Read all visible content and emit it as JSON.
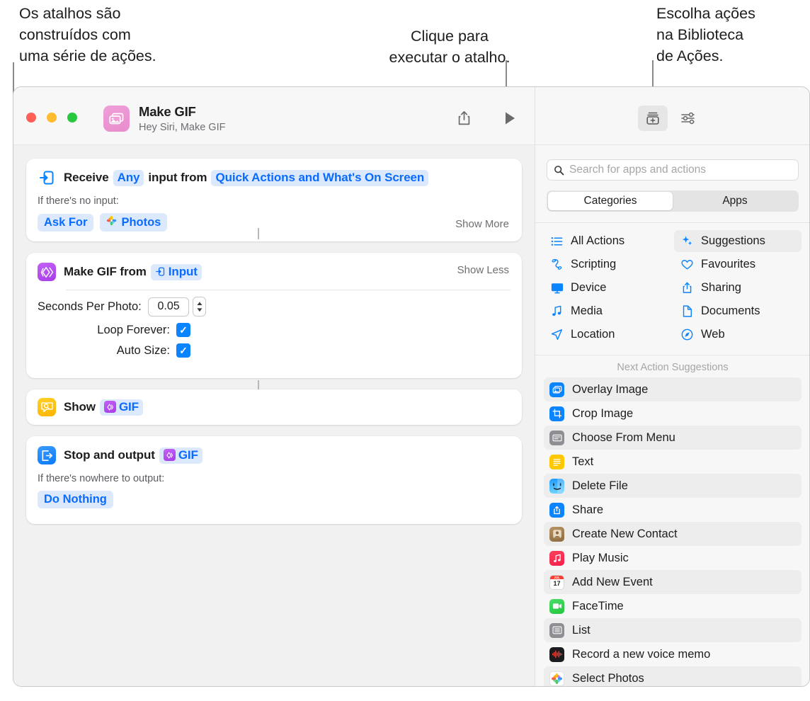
{
  "annotations": {
    "left": "Os atalhos são\nconstruídos com\numa série de ações.",
    "middle": "Clique para\nexecutar o atalho.",
    "right": "Escolha ações\nna Biblioteca\nde Ações."
  },
  "window": {
    "title": "Make GIF",
    "subtitle": "Hey Siri, Make GIF",
    "toolbar": {
      "share": "share-icon",
      "play": "play-icon",
      "library": "action-library-icon",
      "settings": "shortcut-details-icon"
    }
  },
  "actions": [
    {
      "icon": "receive-input-icon",
      "icon_color": "#0a84ff",
      "title_parts": [
        {
          "text": "Receive",
          "type": "plain"
        },
        {
          "text": "Any",
          "type": "token"
        },
        {
          "text": "input from",
          "type": "plain"
        },
        {
          "text": "Quick Actions and What's On Screen",
          "type": "token"
        }
      ],
      "toggle": "Show More",
      "sub_label": "If there's no input:",
      "chips": [
        {
          "label": "Ask For",
          "icon": null
        },
        {
          "label": "Photos",
          "icon": "photos-icon"
        }
      ]
    },
    {
      "icon": "make-gif-icon",
      "icon_color": "#b44cf0",
      "title_parts": [
        {
          "text": "Make GIF from",
          "type": "plain"
        },
        {
          "text": "Input",
          "type": "token",
          "icon": "input-variable-icon"
        }
      ],
      "toggle": "Show Less",
      "params": [
        {
          "label": "Seconds Per Photo:",
          "type": "number",
          "value": "0.05"
        },
        {
          "label": "Loop Forever:",
          "type": "checkbox",
          "checked": true
        },
        {
          "label": "Auto Size:",
          "type": "checkbox",
          "checked": true
        }
      ]
    },
    {
      "icon": "quick-look-icon",
      "icon_color": "#ffc107",
      "title_parts": [
        {
          "text": "Show",
          "type": "plain"
        },
        {
          "text": "GIF",
          "type": "token",
          "icon": "gif-variable-icon"
        }
      ]
    },
    {
      "icon": "stop-output-icon",
      "icon_color": "#0a84ff",
      "title_parts": [
        {
          "text": "Stop and output",
          "type": "plain"
        },
        {
          "text": "GIF",
          "type": "token",
          "icon": "gif-variable-icon"
        }
      ],
      "sub_label": "If there's nowhere to output:",
      "chips": [
        {
          "label": "Do Nothing",
          "icon": null
        }
      ]
    }
  ],
  "sidebar": {
    "search": {
      "placeholder": "Search for apps and actions",
      "icon": "search-icon"
    },
    "tabs": [
      {
        "label": "Categories",
        "active": true
      },
      {
        "label": "Apps",
        "active": false
      }
    ],
    "categories": [
      {
        "label": "All Actions",
        "icon": "list-bullet-icon",
        "selected": false
      },
      {
        "label": "Suggestions",
        "icon": "sparkles-icon",
        "selected": true
      },
      {
        "label": "Scripting",
        "icon": "scroll-icon",
        "selected": false
      },
      {
        "label": "Favourites",
        "icon": "heart-icon",
        "selected": false
      },
      {
        "label": "Device",
        "icon": "display-icon",
        "selected": false
      },
      {
        "label": "Sharing",
        "icon": "share-icon",
        "selected": false
      },
      {
        "label": "Media",
        "icon": "music-note-icon",
        "selected": false
      },
      {
        "label": "Documents",
        "icon": "document-icon",
        "selected": false
      },
      {
        "label": "Location",
        "icon": "paper-plane-icon",
        "selected": false
      },
      {
        "label": "Web",
        "icon": "safari-icon",
        "selected": false
      }
    ],
    "suggestions_title": "Next Action Suggestions",
    "suggestions": [
      {
        "label": "Overlay Image",
        "icon": "overlay-image-icon",
        "color": "#0a84ff"
      },
      {
        "label": "Crop Image",
        "icon": "crop-image-icon",
        "color": "#0a84ff"
      },
      {
        "label": "Choose From Menu",
        "icon": "menu-icon",
        "color": "#8e8e93"
      },
      {
        "label": "Text",
        "icon": "text-icon",
        "color": "#ffc800"
      },
      {
        "label": "Delete File",
        "icon": "finder-icon",
        "color": "#3fa9f5"
      },
      {
        "label": "Share",
        "icon": "share-sheet-icon",
        "color": "#0a84ff"
      },
      {
        "label": "Create New Contact",
        "icon": "contacts-icon",
        "color": "#a07a4f"
      },
      {
        "label": "Play Music",
        "icon": "music-app-icon",
        "color": "#fa2d48"
      },
      {
        "label": "Add New Event",
        "icon": "calendar-icon",
        "color": "#ffffff"
      },
      {
        "label": "FaceTime",
        "icon": "facetime-icon",
        "color": "#32d74b"
      },
      {
        "label": "List",
        "icon": "list-icon",
        "color": "#8e8e93"
      },
      {
        "label": "Record a new voice memo",
        "icon": "voice-memos-icon",
        "color": "#1c1c1e"
      },
      {
        "label": "Select Photos",
        "icon": "photos-icon",
        "color": "#ffffff"
      }
    ]
  },
  "colors": {
    "accent_blue": "#0a6cff",
    "token_bg": "#dce9fd",
    "purple": "#b44cf0",
    "yellow": "#ffc107"
  }
}
